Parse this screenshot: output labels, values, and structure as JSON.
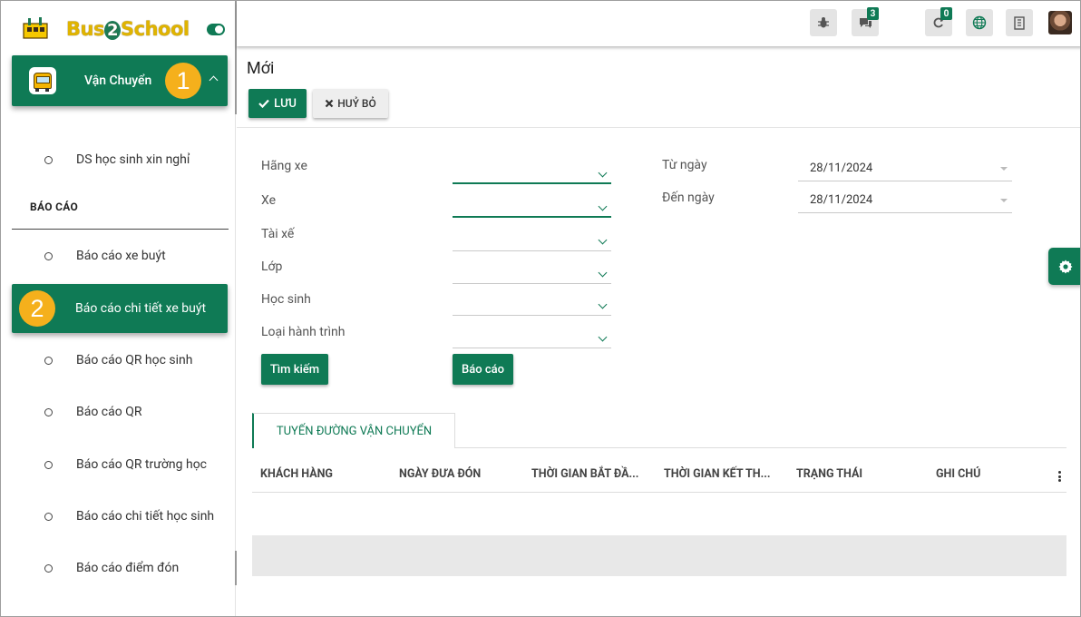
{
  "app": {
    "brand": "Bus2School",
    "brand_prefix": "Bus",
    "brand_number": "2",
    "brand_suffix": "School"
  },
  "sidebar": {
    "group_label": "Vận Chuyển",
    "group_badge": "1",
    "section_title": "BÁO CÁO",
    "items": [
      {
        "label": "DS học sinh xin nghỉ"
      },
      {
        "label": "Báo cáo xe buýt"
      },
      {
        "label": "Báo cáo chi tiết xe buýt",
        "badge": "2",
        "active": true
      },
      {
        "label": "Báo cáo QR học sinh"
      },
      {
        "label": "Báo cáo QR"
      },
      {
        "label": "Báo cáo QR trường học"
      },
      {
        "label": "Báo cáo chi tiết học sinh"
      },
      {
        "label": "Báo cáo điểm đón"
      }
    ]
  },
  "topbar": {
    "messages_count": "3",
    "activity_count": "0"
  },
  "page": {
    "title": "Mới",
    "save_label": "LƯU",
    "cancel_label": "HUỶ BỎ"
  },
  "form": {
    "labels": [
      "Hãng xe",
      "Xe",
      "Tài xế",
      "Lớp",
      "Học sinh",
      "Loại hành trình"
    ],
    "from_date_label": "Từ ngày",
    "from_date_value": "28/11/2024",
    "to_date_label": "Đến ngày",
    "to_date_value": "28/11/2024",
    "search_label": "Tìm kiếm",
    "report_label": "Báo cáo"
  },
  "tab": {
    "label": "TUYẾN ĐƯỜNG VẬN CHUYỂN"
  },
  "table": {
    "columns": [
      "KHÁCH HÀNG",
      "NGÀY ĐƯA ĐÓN",
      "THỜI GIAN BẮT ĐẦ...",
      "THỜI GIAN KẾT TH...",
      "TRẠNG THÁI",
      "GHI CHÚ"
    ]
  },
  "colors": {
    "primary": "#0f7a55",
    "badge": "#f5b01c"
  }
}
